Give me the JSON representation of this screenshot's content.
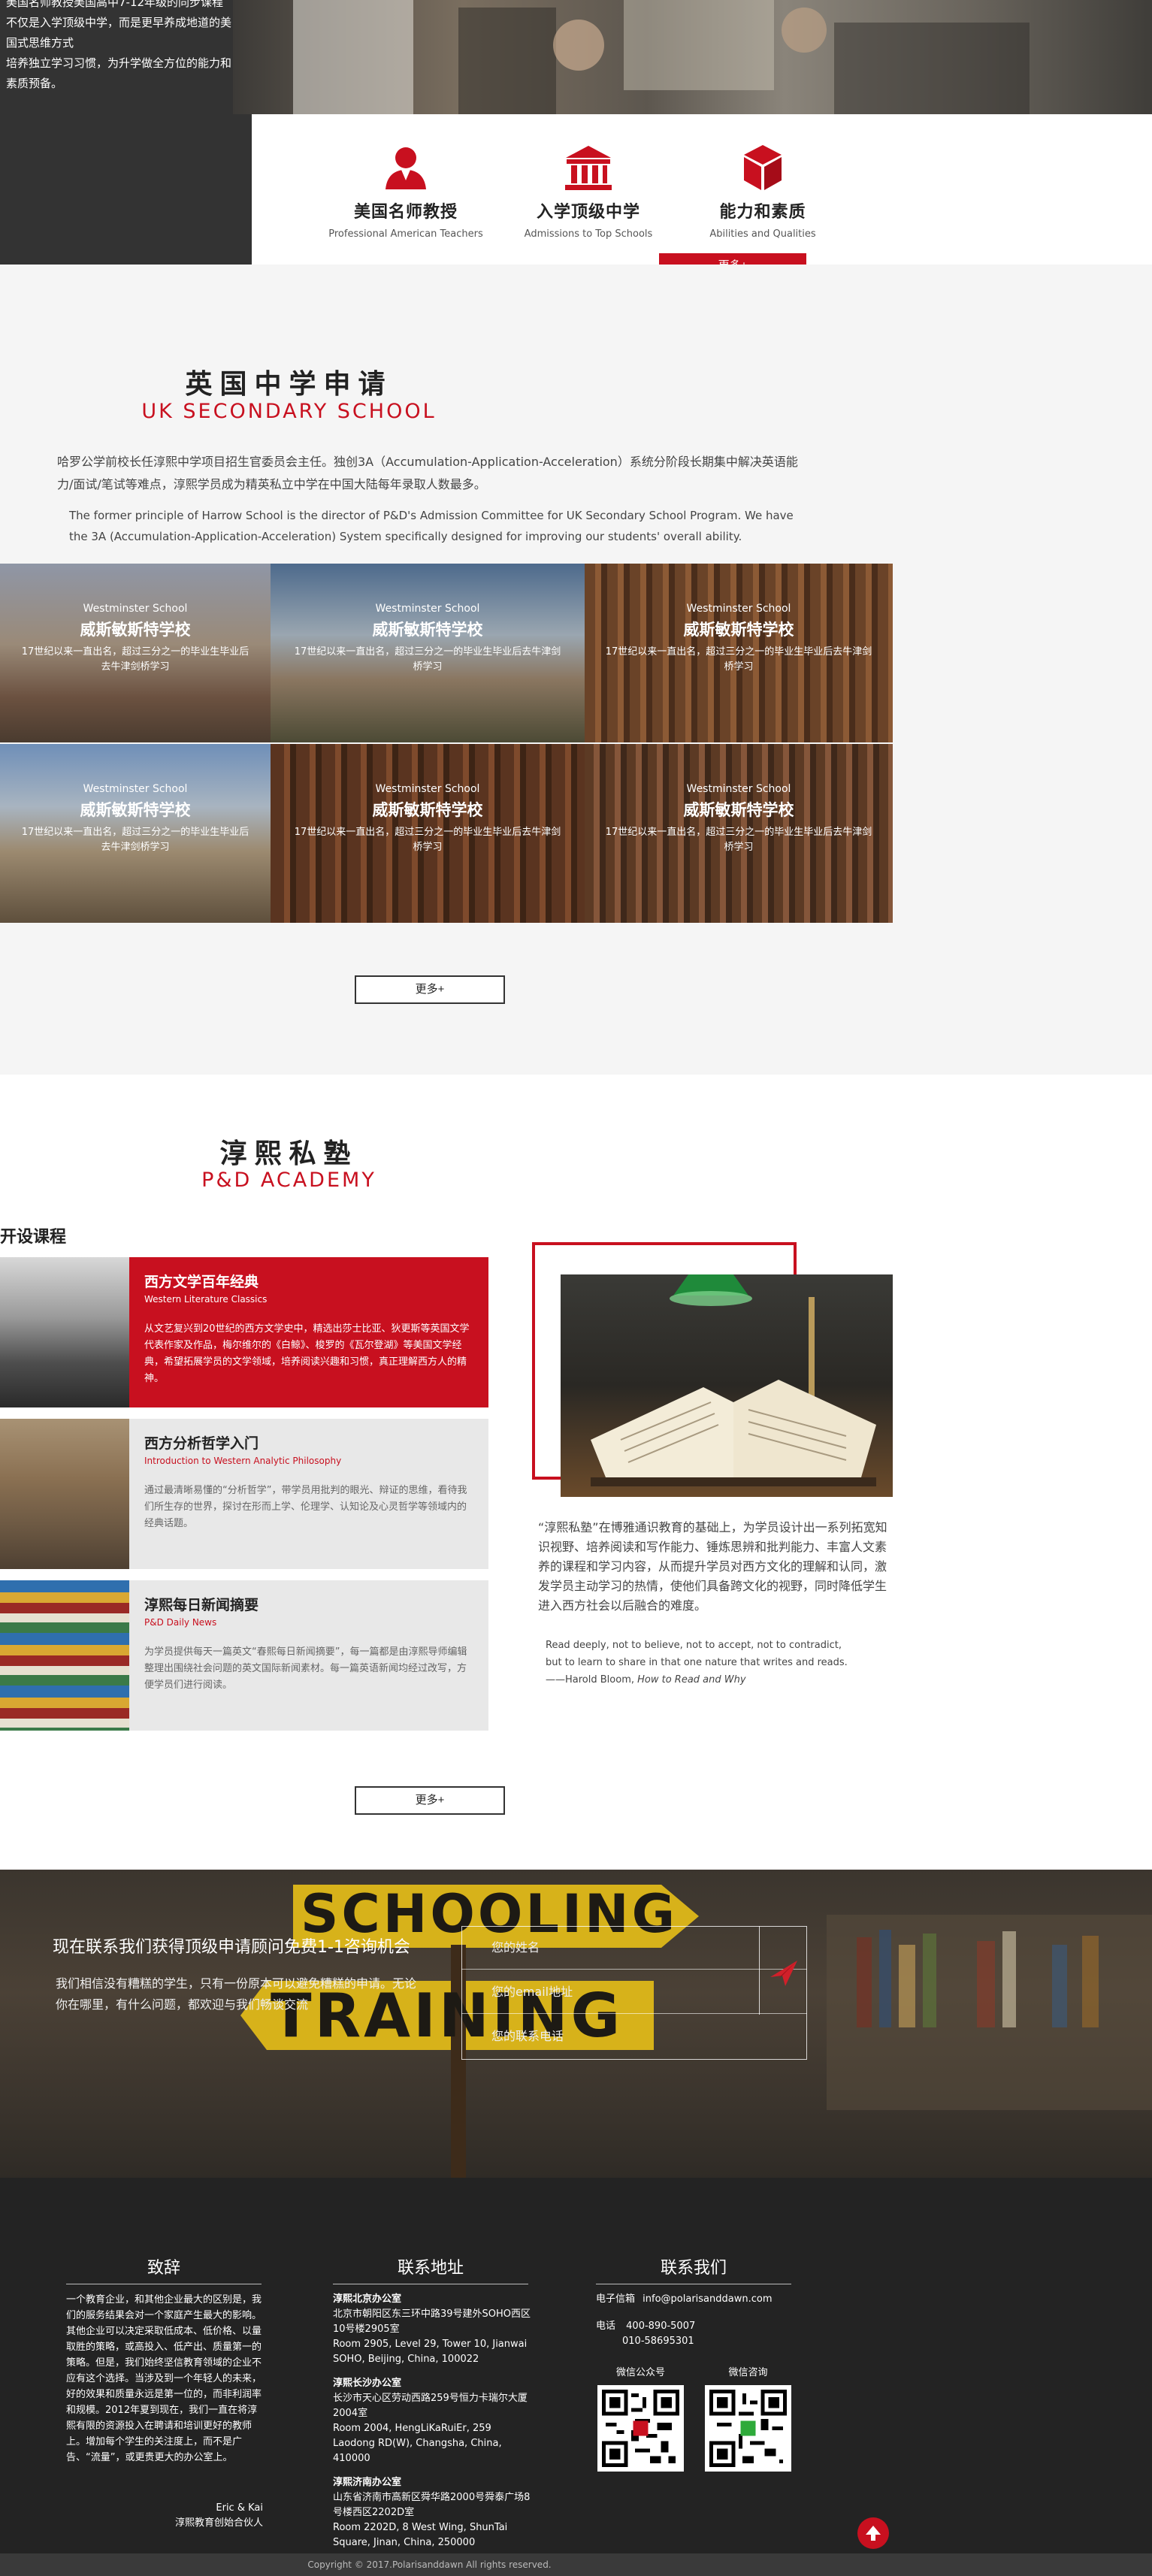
{
  "hero": {
    "intro_lines": [
      "美国名师教授美国高中7-12年级的同步课程",
      "不仅是入学顶级中学，而是更早养成地道的美国式思维方式",
      "培养独立学习习惯，为升学做全方位的能力和素质预备。"
    ],
    "features": [
      {
        "icon": "teacher-icon",
        "title": "美国名师教授",
        "subtitle": "Professional American Teachers"
      },
      {
        "icon": "school-building-icon",
        "title": "入学顶级中学",
        "subtitle": "Admissions to Top Schools"
      },
      {
        "icon": "cube-icon",
        "title": "能力和素质",
        "subtitle": "Abilities and Qualities"
      }
    ],
    "more_label": "更多+"
  },
  "uk": {
    "title_cn": "英国中学申请",
    "title_en": "UK SECONDARY SCHOOL",
    "para_cn": "哈罗公学前校长任淳熙中学项目招生官委员会主任。独创3A（Accumulation-Application-Acceleration）系统分阶段长期集中解决英语能力/面试/笔试等难点，淳熙学员成为精英私立中学在中国大陆每年录取人数最多。",
    "para_en": "The former principle of Harrow School is the director of P&D's Admission Committee for UK Secondary School Program. We have the 3A (Accumulation-Application-Acceleration) System specifically designed for improving our students' overall ability.",
    "schools": [
      {
        "en": "Westminster School",
        "cn": "威斯敏斯特学校",
        "desc": "17世纪以来一直出名，超过三分之一的毕业生毕业后去牛津剑桥学习"
      },
      {
        "en": "Westminster School",
        "cn": "威斯敏斯特学校",
        "desc": "17世纪以来一直出名，超过三分之一的毕业生毕业后去牛津剑桥学习"
      },
      {
        "en": "Westminster School",
        "cn": "威斯敏斯特学校",
        "desc": "17世纪以来一直出名，超过三分之一的毕业生毕业后去牛津剑桥学习"
      },
      {
        "en": "Westminster School",
        "cn": "威斯敏斯特学校",
        "desc": "17世纪以来一直出名，超过三分之一的毕业生毕业后去牛津剑桥学习"
      },
      {
        "en": "Westminster School",
        "cn": "威斯敏斯特学校",
        "desc": "17世纪以来一直出名，超过三分之一的毕业生毕业后去牛津剑桥学习"
      },
      {
        "en": "Westminster School",
        "cn": "威斯敏斯特学校",
        "desc": "17世纪以来一直出名，超过三分之一的毕业生毕业后去牛津剑桥学习"
      }
    ],
    "more_label": "更多+"
  },
  "academy": {
    "title_cn": "淳熙私塾",
    "title_en": "P&D ACADEMY",
    "courses_heading": "开设课程",
    "courses": [
      {
        "title": "西方文学百年经典",
        "en": "Western Literature Classics",
        "desc": "从文艺复兴到20世纪的西方文学史中，精选出莎士比亚、狄更斯等英国文学代表作家及作品，梅尔维尔的《白鲸》、梭罗的《瓦尔登湖》等美国文学经典，希望拓展学员的文学领域，培养阅读兴趣和习惯，真正理解西方人的精神。"
      },
      {
        "title": "西方分析哲学入门",
        "en": "Introduction to Western Analytic Philosophy",
        "desc": "通过最清晰易懂的“分析哲学”，带学员用批判的眼光、辩证的思维，看待我们所生存的世界，探讨在形而上学、伦理学、认知论及心灵哲学等领域内的经典话题。"
      },
      {
        "title": "淳熙每日新闻摘要",
        "en": "P&D Daily News",
        "desc": "为学员提供每天一篇英文“春熙每日新闻摘要”，每一篇都是由淳熙导师编辑整理出围绕社会问题的英文国际新闻素材。每一篇英语新闻均经过改写，方便学员们进行阅读。"
      }
    ],
    "quote_cn": "“淳熙私塾”在博雅通识教育的基础上，为学员设计出一系列拓宽知识视野、培养阅读和写作能力、锤炼思辨和批判能力、丰富人文素养的课程和学习内容，从而提升学员对西方文化的理解和认同，激发学员主动学习的热情，使他们具备跨文化的视野，同时降低学生进入西方社会以后融合的难度。",
    "quote_en_1": "Read deeply, not to believe, not to accept, not to contradict,",
    "quote_en_2": "but to learn to share in that one nature that writes and reads.",
    "quote_author": "——Harold Bloom, ",
    "quote_book": "How to Read and Why",
    "more_label": "更多+"
  },
  "contact_banner": {
    "title": "现在联系我们获得顶级申请顾问免费1-1咨询机会",
    "text": "我们相信没有糟糕的学生，只有一份原本可以避免糟糕的申请。无论你在哪里，有什么问题，都欢迎与我们畅谈交流",
    "sign_top": "SCHOOLING",
    "sign_bottom": "TRAINING",
    "name_placeholder": "您的姓名",
    "email_placeholder": "您的email地址",
    "phone_placeholder": "您的联系电话"
  },
  "footer": {
    "col1_title": "致辞",
    "col1_text": "一个教育企业，和其他企业最大的区别是，我们的服务结果会对一个家庭产生最大的影响。其他企业可以决定采取低成本、低价格、以量取胜的策略，或高投入、低产出、质量第一的策略。但是，我们始终坚信教育领域的企业不应有这个选择。当涉及到一个年轻人的未来，好的效果和质量永远是第一位的，而非利润率和规模。2012年夏到现在，我们一直在将淳熙有限的资源投入在聘请和培训更好的教师上。增加每个学生的关注度上，而不是广告、“流量”，或更贵更大的办公室上。",
    "col1_sign_1": "Eric & Kai",
    "col1_sign_2": "淳熙教育创始合伙人",
    "col2_title": "联系地址",
    "offices": [
      {
        "name": "淳熙北京办公室",
        "cn": "北京市朝阳区东三环中路39号建外SOHO西区10号楼2905室",
        "en": "Room 2905, Level 29, Tower 10, Jianwai SOHO, Beijing, China, 100022"
      },
      {
        "name": "淳熙长沙办公室",
        "cn": "长沙市天心区劳动西路259号恒力卡瑞尔大厦2004室",
        "en": "Room 2004, HengLiKaRuiEr, 259 Laodong RD(W), Changsha, China, 410000"
      },
      {
        "name": "淳熙济南办公室",
        "cn": "山东省济南市高新区舜华路2000号舜泰广场8号楼西区2202D室",
        "en": "Room 2202D, 8 West Wing, ShunTai Square, Jinan, China, 250000"
      }
    ],
    "col3_title": "联系我们",
    "email_label": "电子信箱",
    "email": "info@polarisanddawn.com",
    "phone_label": "电话",
    "phone_1": "400-890-5007",
    "phone_2": "010-58695301",
    "qr_1": "微信公众号",
    "qr_2": "微信咨询",
    "copyright": "Copyright © 2017.Polarisanddawn All rights reserved."
  },
  "colors": {
    "accent": "#c8101f",
    "dark": "#333333",
    "footer": "#232323"
  }
}
